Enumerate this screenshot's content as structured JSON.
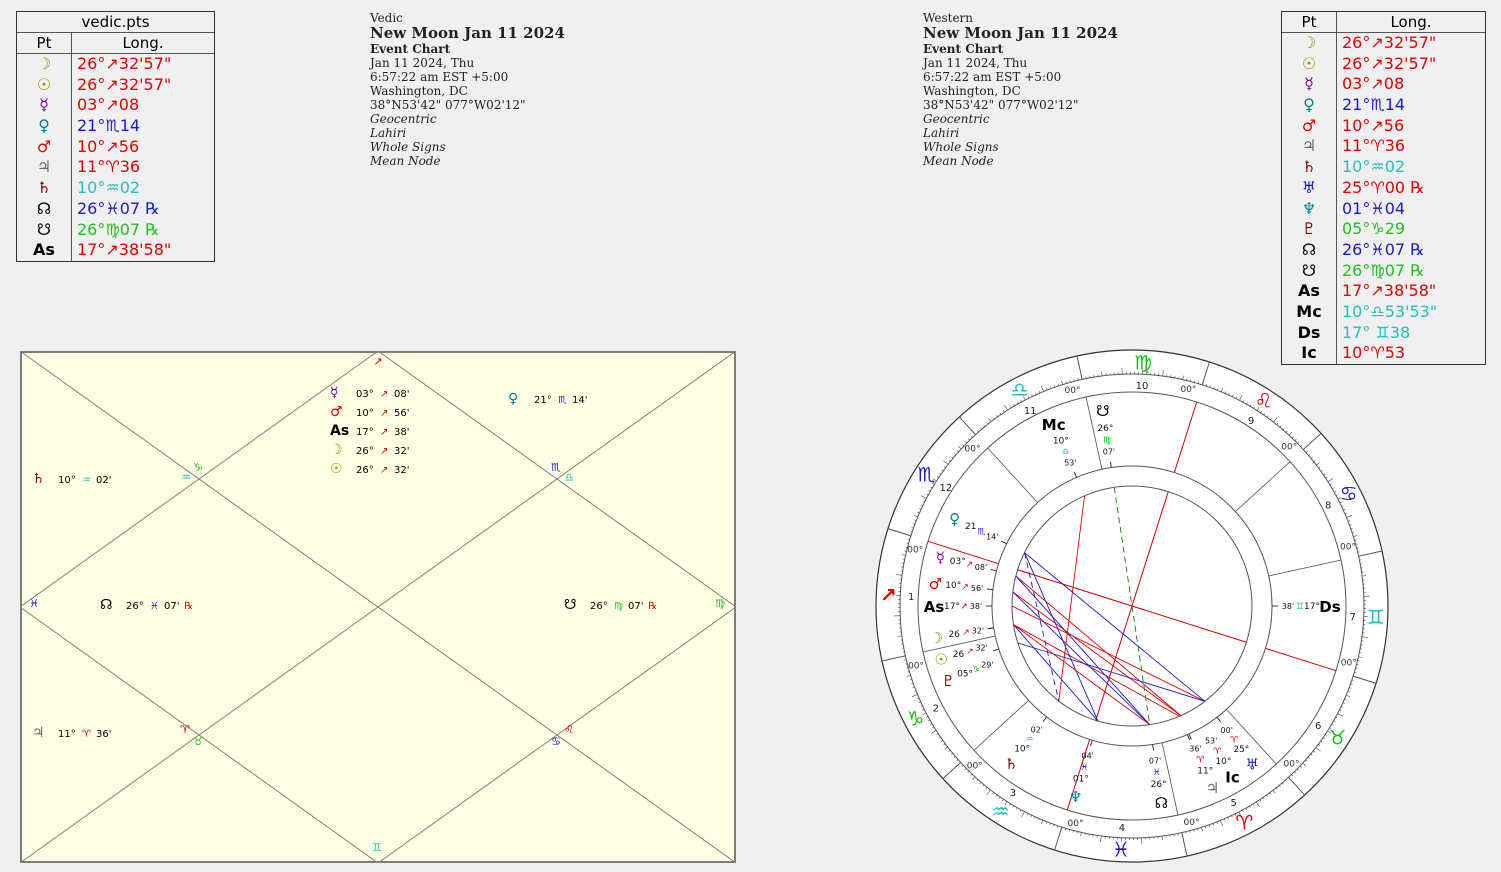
{
  "vedic_table": {
    "title": "vedic.pts",
    "col_pt": "Pt",
    "col_long": "Long.",
    "rows": [
      {
        "glyph": "☽",
        "glyph_color": "#a88b00",
        "long": "26°↗32'57\"",
        "color": "#e60000"
      },
      {
        "glyph": "☉",
        "glyph_color": "#a88b00",
        "long": "26°↗32'57\"",
        "color": "#e60000"
      },
      {
        "glyph": "☿",
        "glyph_color": "#8000a0",
        "long": "03°↗08",
        "color": "#e60000"
      },
      {
        "glyph": "♀",
        "glyph_color": "#00808c",
        "long": "21°♏14",
        "color": "#1a1ad0"
      },
      {
        "glyph": "♂",
        "glyph_color": "#e00000",
        "long": "10°↗56",
        "color": "#e60000"
      },
      {
        "glyph": "♃",
        "glyph_color": "#666666",
        "long": "11°♈36",
        "color": "#e60000"
      },
      {
        "glyph": "♄",
        "glyph_color": "#800000",
        "long": "10°♒02",
        "color": "#20c0c0"
      },
      {
        "glyph": "☊",
        "glyph_color": "#000000",
        "long": "26°♓07 ℞",
        "color": "#1a1ad0"
      },
      {
        "glyph": "☋",
        "glyph_color": "#000000",
        "long": "26°♍07 ℞",
        "color": "#20c020"
      },
      {
        "glyph": "As",
        "glyph_color": "#000000",
        "long": "17°↗38'58\"",
        "color": "#e60000"
      }
    ]
  },
  "western_table": {
    "col_pt": "Pt",
    "col_long": "Long.",
    "rows": [
      {
        "glyph": "☽",
        "glyph_color": "#a88b00",
        "long": "26°↗32'57\"",
        "color": "#e60000"
      },
      {
        "glyph": "☉",
        "glyph_color": "#a88b00",
        "long": "26°↗32'57\"",
        "color": "#e60000"
      },
      {
        "glyph": "☿",
        "glyph_color": "#8000a0",
        "long": "03°↗08",
        "color": "#e60000"
      },
      {
        "glyph": "♀",
        "glyph_color": "#00808c",
        "long": "21°♏14",
        "color": "#1a1ad0"
      },
      {
        "glyph": "♂",
        "glyph_color": "#e00000",
        "long": "10°↗56",
        "color": "#e60000"
      },
      {
        "glyph": "♃",
        "glyph_color": "#666666",
        "long": "11°♈36",
        "color": "#e60000"
      },
      {
        "glyph": "♄",
        "glyph_color": "#800000",
        "long": "10°♒02",
        "color": "#20c0c0"
      },
      {
        "glyph": "♅",
        "glyph_color": "#1a1ad0",
        "long": "25°♈00 ℞",
        "color": "#e60000"
      },
      {
        "glyph": "♆",
        "glyph_color": "#00808c",
        "long": "01°♓04",
        "color": "#1a1ad0"
      },
      {
        "glyph": "♇",
        "glyph_color": "#800000",
        "long": "05°♑29",
        "color": "#20c020"
      },
      {
        "glyph": "☊",
        "glyph_color": "#000000",
        "long": "26°♓07 ℞",
        "color": "#1a1ad0"
      },
      {
        "glyph": "☋",
        "glyph_color": "#000000",
        "long": "26°♍07 ℞",
        "color": "#20c020"
      },
      {
        "glyph": "As",
        "glyph_color": "#000000",
        "long": "17°↗38'58\"",
        "color": "#e60000"
      },
      {
        "glyph": "Mc",
        "glyph_color": "#000000",
        "long": "10°♎53'53\"",
        "color": "#20c0c0"
      },
      {
        "glyph": "Ds",
        "glyph_color": "#000000",
        "long": "17° ♊38",
        "color": "#20c0c0"
      },
      {
        "glyph": "Ic",
        "glyph_color": "#000000",
        "long": "10°♈53",
        "color": "#e60000"
      }
    ]
  },
  "vedic_header": {
    "type": "Vedic",
    "title": "New Moon Jan 11 2024",
    "subtitle": "Event Chart",
    "date": "Jan 11 2024, Thu",
    "time": "6:57:22 am  EST +5:00",
    "place": "Washington, DC",
    "coords": "38°N53'42\" 077°W02'12\"",
    "opt1": "Geocentric",
    "opt2": "Lahiri",
    "opt3": "Whole Signs",
    "opt4": "Mean Node"
  },
  "western_header": {
    "type": "Western",
    "title": "New Moon Jan 11 2024",
    "subtitle": "Event Chart",
    "date": "Jan 11 2024, Thu",
    "time": "6:57:22 am  EST +5:00",
    "place": "Washington, DC",
    "coords": "38°N53'42\" 077°W02'12\"",
    "opt1": "Geocentric",
    "opt2": "Lahiri",
    "opt3": "Whole Signs",
    "opt4": "Mean Node"
  },
  "north_indian_chart": {
    "colors": {
      "bg": "#ffffe6",
      "line": "#808080"
    },
    "house_signs": [
      {
        "g": "↗",
        "c": "#e60000"
      },
      {
        "g": "♑",
        "c": "#20c020"
      },
      {
        "g": "♒",
        "c": "#20c0c0"
      },
      {
        "g": "♓",
        "c": "#1a1ad0"
      },
      {
        "g": "♈",
        "c": "#e60000"
      },
      {
        "g": "♉",
        "c": "#20c020"
      },
      {
        "g": "♊",
        "c": "#20c0c0"
      },
      {
        "g": "♋",
        "c": "#1a1ad0"
      },
      {
        "g": "♌",
        "c": "#e60000"
      },
      {
        "g": "♍",
        "c": "#20c020"
      },
      {
        "g": "♎",
        "c": "#20c0c0"
      },
      {
        "g": "♏",
        "c": "#1a1ad0"
      }
    ],
    "planet_blocks": [
      {
        "house": 1,
        "items": [
          {
            "g": "☿",
            "gc": "#8000a0",
            "deg": "03°",
            "s": "↗",
            "sc": "#e60000",
            "min": "08'"
          },
          {
            "g": "♂",
            "gc": "#e00000",
            "deg": "10°",
            "s": "↗",
            "sc": "#e60000",
            "min": "56'"
          },
          {
            "g": "As",
            "gc": "#000000",
            "deg": "17°",
            "s": "↗",
            "sc": "#e60000",
            "min": "38'"
          },
          {
            "g": "☽",
            "gc": "#a88b00",
            "deg": "26°",
            "s": "↗",
            "sc": "#e60000",
            "min": "32'"
          },
          {
            "g": "☉",
            "gc": "#a88b00",
            "deg": "26°",
            "s": "↗",
            "sc": "#e60000",
            "min": "32'"
          }
        ]
      },
      {
        "house": 12,
        "items": [
          {
            "g": "♀",
            "gc": "#00808c",
            "deg": "21°",
            "s": "♏",
            "sc": "#1a1ad0",
            "min": "14'"
          }
        ]
      },
      {
        "house": 3,
        "items": [
          {
            "g": "♄",
            "gc": "#800000",
            "deg": "10°",
            "s": "♒",
            "sc": "#20c0c0",
            "min": "02'"
          }
        ]
      },
      {
        "house": 4,
        "items": [
          {
            "g": "☊",
            "gc": "#000000",
            "deg": "26°",
            "s": "♓",
            "sc": "#1a1ad0",
            "min": "07'",
            "rx": "℞"
          }
        ]
      },
      {
        "house": 10,
        "items": [
          {
            "g": "☋",
            "gc": "#000000",
            "deg": "26°",
            "s": "♍",
            "sc": "#20c020",
            "min": "07'",
            "rx": "℞"
          }
        ]
      },
      {
        "house": 5,
        "items": [
          {
            "g": "♃",
            "gc": "#666666",
            "deg": "11°",
            "s": "♈",
            "sc": "#e60000",
            "min": "36'"
          }
        ]
      }
    ]
  },
  "wheel": {
    "colors": {
      "red": "#e00000",
      "blue": "#1a1ad0",
      "green": "#108010"
    },
    "outer_degree_label": "00°",
    "house_numbers": [
      "1",
      "2",
      "3",
      "4",
      "5",
      "6",
      "7",
      "8",
      "9",
      "10",
      "11",
      "12"
    ],
    "zodiac": [
      {
        "g": "↗",
        "c": "#e00000"
      },
      {
        "g": "♑",
        "c": "#10c010"
      },
      {
        "g": "♒",
        "c": "#20c0c0"
      },
      {
        "g": "♓",
        "c": "#1a1ad0"
      },
      {
        "g": "♈",
        "c": "#e00000"
      },
      {
        "g": "♉",
        "c": "#10c010"
      },
      {
        "g": "♊",
        "c": "#20c0c0"
      },
      {
        "g": "♋",
        "c": "#1a1ad0"
      },
      {
        "g": "♌",
        "c": "#e00000"
      },
      {
        "g": "♍",
        "c": "#10c010"
      },
      {
        "g": "♎",
        "c": "#20c0c0"
      },
      {
        "g": "♏",
        "c": "#1a1ad0"
      }
    ],
    "bodies": [
      {
        "g": "☽",
        "gc": "#a88b00",
        "deg": "26",
        "s": "↗",
        "sc": "#e00000",
        "min": "32'",
        "lon": 266.55
      },
      {
        "g": "☉",
        "gc": "#a88b00",
        "deg": "26",
        "s": "↗",
        "sc": "#e00000",
        "min": "32'",
        "lon": 266.55
      },
      {
        "g": "☿",
        "gc": "#8000a0",
        "deg": "03°",
        "s": "↗",
        "sc": "#e00000",
        "min": "08'",
        "lon": 243.1
      },
      {
        "g": "♀",
        "gc": "#00808c",
        "deg": "21",
        "s": "♏",
        "sc": "#1a1ad0",
        "min": "14'",
        "lon": 231.2
      },
      {
        "g": "♂",
        "gc": "#e00000",
        "deg": "10°",
        "s": "↗",
        "sc": "#e00000",
        "min": "56'",
        "lon": 250.9
      },
      {
        "g": "As",
        "gc": "#000000",
        "deg": "17°",
        "s": "↗",
        "sc": "#e00000",
        "min": "38'",
        "lon": 257.6
      },
      {
        "g": "♃",
        "gc": "#666666",
        "deg": "11°",
        "s": "♈",
        "sc": "#e00000",
        "min": "36'",
        "lon": 11.6
      },
      {
        "g": "♄",
        "gc": "#800000",
        "deg": "10°",
        "s": "♒",
        "sc": "#20c0c0",
        "min": "02'",
        "lon": 310.0
      },
      {
        "g": "♅",
        "gc": "#1a1ad0",
        "deg": "25°",
        "s": "♈",
        "sc": "#e00000",
        "min": "00'",
        "lon": 25.0
      },
      {
        "g": "♆",
        "gc": "#00808c",
        "deg": "01°",
        "s": "♓",
        "sc": "#1a1ad0",
        "min": "04'",
        "lon": 331.1
      },
      {
        "g": "♇",
        "gc": "#800000",
        "deg": "05°",
        "s": "♑",
        "sc": "#10c010",
        "min": "29'",
        "lon": 275.5
      },
      {
        "g": "☊",
        "gc": "#000000",
        "deg": "26°",
        "s": "♓",
        "sc": "#1a1ad0",
        "min": "07'",
        "lon": 356.1
      },
      {
        "g": "☋",
        "gc": "#000000",
        "deg": "26°",
        "s": "♍",
        "sc": "#10c010",
        "min": "07'",
        "lon": 176.1
      },
      {
        "g": "Mc",
        "gc": "#000000",
        "deg": "10°",
        "s": "♎",
        "sc": "#20c0c0",
        "min": "53'",
        "lon": 190.9
      },
      {
        "g": "Ic",
        "gc": "#000000",
        "deg": "10°",
        "s": "♈",
        "sc": "#e00000",
        "min": "53'",
        "lon": 10.9
      },
      {
        "g": "Ds",
        "gc": "#000000",
        "deg": "17°",
        "s": "♊",
        "sc": "#20c0c0",
        "min": "38'",
        "lon": 77.6
      }
    ],
    "aspects": [
      {
        "a": 243.1,
        "b": 11.6,
        "c": "#e00000"
      },
      {
        "a": 250.9,
        "b": 11.6,
        "c": "#e00000"
      },
      {
        "a": 266.55,
        "b": 10.9,
        "c": "#e00000"
      },
      {
        "a": 257.6,
        "b": 25.0,
        "c": "#e00000"
      },
      {
        "a": 231.2,
        "b": 331.1,
        "c": "#1a1ad0"
      },
      {
        "a": 266.55,
        "b": 331.1,
        "c": "#1a1ad0"
      },
      {
        "a": 243.1,
        "b": 356.1,
        "c": "#1a1ad0"
      },
      {
        "a": 250.9,
        "b": 356.1,
        "c": "#1a1ad0"
      },
      {
        "a": 190.9,
        "b": 310.0,
        "c": "#e00000"
      },
      {
        "a": 275.5,
        "b": 25.0,
        "c": "#1a1ad0"
      },
      {
        "a": 231.2,
        "b": 25.0,
        "c": "#1a1ad0"
      },
      {
        "a": 176.1,
        "b": 356.1,
        "c": "#108010",
        "dash": true
      },
      {
        "a": 231.2,
        "b": 310.0,
        "c": "#1a1ad0",
        "dash": true
      },
      {
        "a": 266.55,
        "b": 356.1,
        "c": "#e00000"
      }
    ]
  }
}
